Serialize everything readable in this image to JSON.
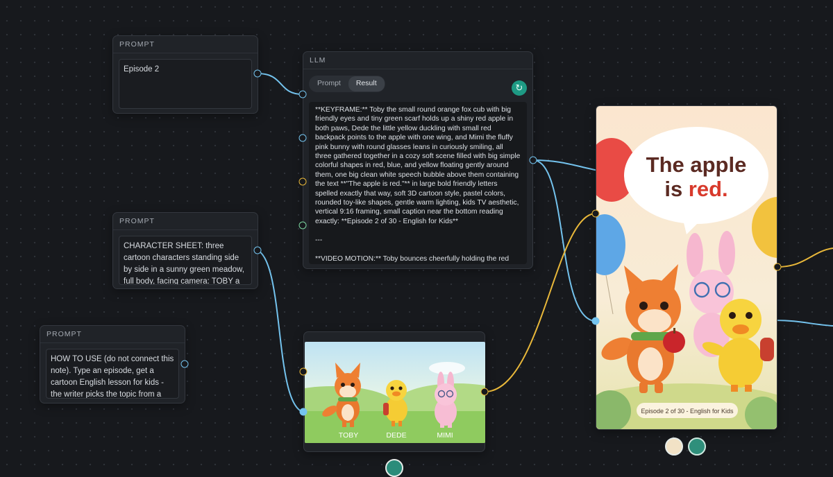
{
  "prompt_nodes": [
    {
      "header": "PROMPT",
      "text": "Episode 2"
    },
    {
      "header": "PROMPT",
      "text": "CHARACTER SHEET: three cartoon characters standing side by side in a sunny green meadow, full body, facing camera: TOBY a small round"
    },
    {
      "header": "PROMPT",
      "text": "HOW TO USE (do not connect this note). Type an episode, get a cartoon English lesson for kids - the writer picks the topic from a built in"
    }
  ],
  "llm_node": {
    "header": "LLM",
    "tabs": [
      "Prompt",
      "Result"
    ],
    "active_tab": "Result",
    "refresh_icon": "refresh-icon",
    "result_text": "**KEYFRAME:** Toby the small round orange fox cub with big friendly eyes and tiny green scarf holds up a shiny red apple in both paws, Dede the little yellow duckling with small red backpack points to the apple with one wing, and Mimi the fluffy pink bunny with round glasses leans in curiously smiling, all three gathered together in a cozy soft scene filled with big simple colorful shapes in red, blue, and yellow floating gently around them, one big clean white speech bubble above them containing the text **\"The apple is red.\"** in large bold friendly letters spelled exactly that way, soft 3D cartoon style, pastel colors, rounded toy-like shapes, gentle warm lighting, kids TV aesthetic, vertical 9:16 framing, small caption near the bottom reading exactly: **Episode 2 of 30 - English for Kids**\n\n---\n\n**VIDEO MOTION:** Toby bounces cheerfully holding the red"
  },
  "character_image": {
    "labels": [
      "TOBY",
      "DEDE",
      "MIMI"
    ]
  },
  "keyframe_image": {
    "bubble_line1": "The apple",
    "bubble_line2_prefix": "is ",
    "bubble_highlight": "red.",
    "caption": "Episode 2 of 30 - English for Kids"
  },
  "colors": {
    "edge_blue": "#74c3ee",
    "edge_yellow": "#e9b83a",
    "edge_green": "#7cd7a1",
    "accent_teal": "#1e9a84",
    "canvas_bg": "#17191d",
    "bubble_text": "#5b2a22",
    "bubble_red": "#d83a2c"
  }
}
